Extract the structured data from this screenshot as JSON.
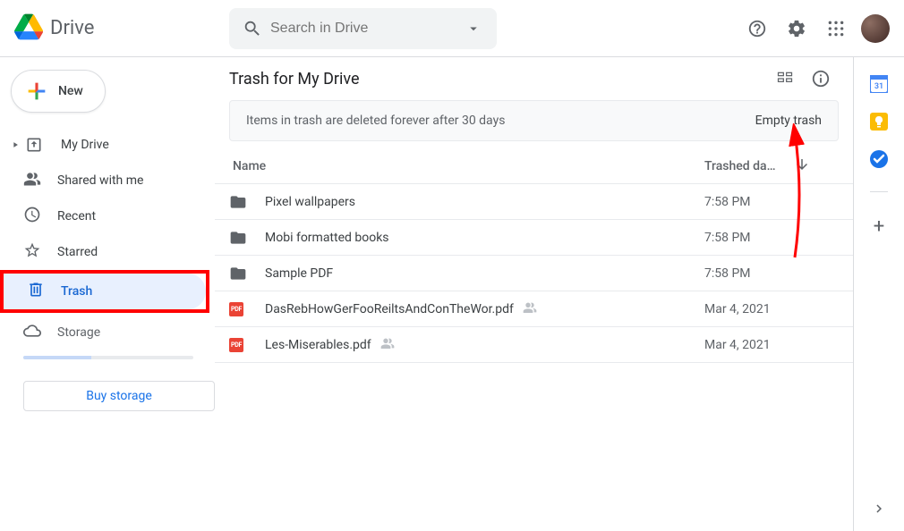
{
  "app": {
    "name": "Drive"
  },
  "search": {
    "placeholder": "Search in Drive"
  },
  "new_button": {
    "label": "New"
  },
  "sidebar": {
    "items": [
      {
        "label": "My Drive"
      },
      {
        "label": "Shared with me"
      },
      {
        "label": "Recent"
      },
      {
        "label": "Starred"
      },
      {
        "label": "Trash"
      }
    ],
    "storage_label": "Storage",
    "buy_storage_label": "Buy storage"
  },
  "content": {
    "title": "Trash for My Drive",
    "banner_text": "Items in trash are deleted forever after 30 days",
    "banner_action": "Empty trash",
    "columns": {
      "name": "Name",
      "date": "Trashed da…"
    },
    "rows": [
      {
        "type": "folder",
        "name": "Pixel wallpapers",
        "date": "7:58 PM",
        "shared": false
      },
      {
        "type": "folder",
        "name": "Mobi formatted books",
        "date": "7:58 PM",
        "shared": false
      },
      {
        "type": "folder",
        "name": "Sample PDF",
        "date": "7:58 PM",
        "shared": false
      },
      {
        "type": "pdf",
        "name": "DasRebHowGerFooReiltsAndConTheWor.pdf",
        "date": "Mar 4, 2021",
        "shared": true
      },
      {
        "type": "pdf",
        "name": "Les-Miserables.pdf",
        "date": "Mar 4, 2021",
        "shared": true
      }
    ]
  },
  "sidepanel": {
    "calendar_day": "31"
  }
}
